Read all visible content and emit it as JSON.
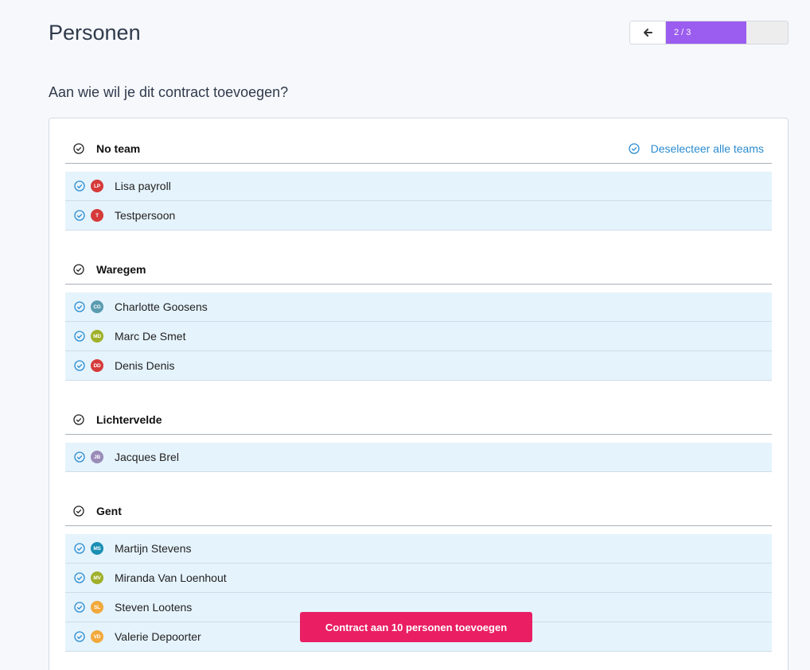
{
  "page": {
    "title": "Personen",
    "question": "Aan wie wil je dit contract toevoegen?"
  },
  "stepper": {
    "progress_label": "2 / 3",
    "current_step": 2,
    "total_steps": 3,
    "back_icon": "arrow-left-icon"
  },
  "deselect_all_label": "Deselecteer alle teams",
  "teams": [
    {
      "name": "No team",
      "members": [
        {
          "initials": "LP",
          "name": "Lisa payroll",
          "color": "#d63a3a"
        },
        {
          "initials": "T",
          "name": "Testpersoon",
          "color": "#d63a3a"
        }
      ]
    },
    {
      "name": "Waregem",
      "members": [
        {
          "initials": "CG",
          "name": "Charlotte Goosens",
          "color": "#5b9bb0"
        },
        {
          "initials": "MD",
          "name": "Marc De Smet",
          "color": "#a0b02a"
        },
        {
          "initials": "DD",
          "name": "Denis Denis",
          "color": "#d63a3a"
        }
      ]
    },
    {
      "name": "Lichtervelde",
      "members": [
        {
          "initials": "JB",
          "name": "Jacques Brel",
          "color": "#9a8bb8"
        }
      ]
    },
    {
      "name": "Gent",
      "members": [
        {
          "initials": "MS",
          "name": "Martijn Stevens",
          "color": "#1a8fb3"
        },
        {
          "initials": "MV",
          "name": "Miranda Van Loenhout",
          "color": "#a0b02a"
        },
        {
          "initials": "SL",
          "name": "Steven Lootens",
          "color": "#f2a93b"
        },
        {
          "initials": "VD",
          "name": "Valerie Depoorter",
          "color": "#f2a93b"
        }
      ]
    }
  ],
  "submit_label": "Contract aan 10 personen toevoegen",
  "colors": {
    "accent": "#9b5cf0",
    "primary_button": "#e91e63",
    "link": "#2a8bd0",
    "selected_row": "#e5f3fc"
  }
}
